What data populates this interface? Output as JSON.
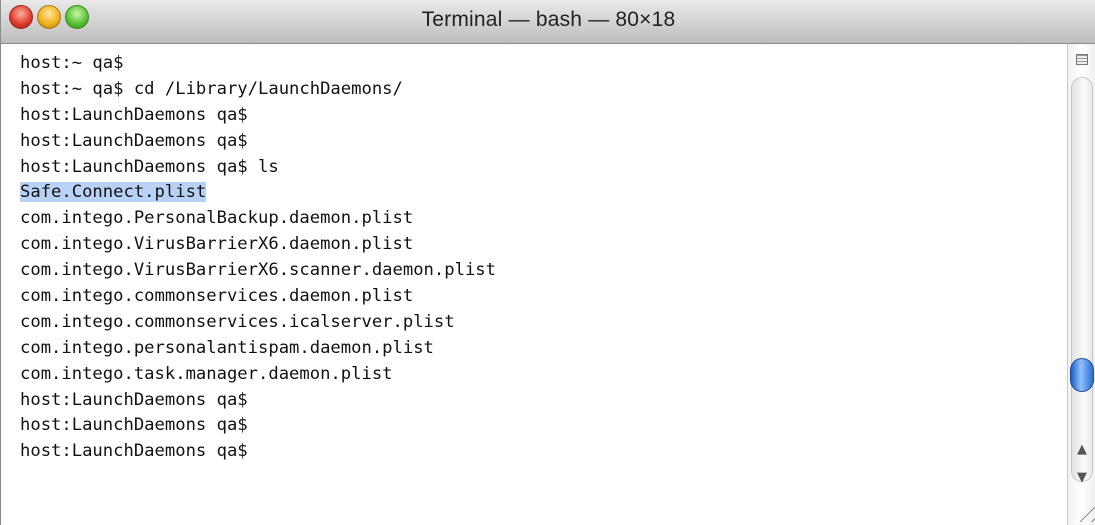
{
  "window": {
    "title": "Terminal — bash — 80×18",
    "controls": [
      "close-button",
      "minimize-button",
      "zoom-button"
    ]
  },
  "terminal": {
    "lines": [
      "host:~ qa$",
      "host:~ qa$ cd /Library/LaunchDaemons/",
      "host:LaunchDaemons qa$",
      "host:LaunchDaemons qa$",
      "host:LaunchDaemons qa$ ls",
      "Safe.Connect.plist",
      "com.intego.PersonalBackup.daemon.plist",
      "com.intego.VirusBarrierX6.daemon.plist",
      "com.intego.VirusBarrierX6.scanner.daemon.plist",
      "com.intego.commonservices.daemon.plist",
      "com.intego.commonservices.icalserver.plist",
      "com.intego.personalantispam.daemon.plist",
      "com.intego.task.manager.daemon.plist",
      "host:LaunchDaemons qa$",
      "host:LaunchDaemons qa$",
      "host:LaunchDaemons qa$"
    ],
    "selected_line_index": 5,
    "selection_color": "#b8d2f5"
  },
  "scrollbar": {
    "up_arrow": "▲",
    "down_arrow": "▼",
    "icons": [
      "split-pane-icon",
      "resize-grip-icon"
    ]
  }
}
